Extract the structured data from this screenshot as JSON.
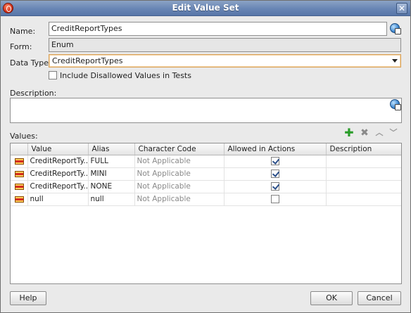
{
  "window": {
    "title": "Edit Value Set"
  },
  "form": {
    "name_label": "Name:",
    "name_value": "CreditReportTypes",
    "form_label": "Form:",
    "form_value": "Enum",
    "datatype_label": "Data Type:",
    "datatype_value": "CreditReportTypes",
    "include_disallowed_label": "Include Disallowed Values in Tests",
    "include_disallowed_checked": false,
    "description_label": "Description:",
    "description_value": ""
  },
  "values": {
    "label": "Values:",
    "columns": [
      "Value",
      "Alias",
      "Character Code",
      "Allowed in Actions",
      "Description"
    ],
    "rows": [
      {
        "value": "CreditReportTy...",
        "alias": "FULL",
        "char_code": "Not Applicable",
        "allowed": true,
        "description": ""
      },
      {
        "value": "CreditReportTy...",
        "alias": "MINI",
        "char_code": "Not Applicable",
        "allowed": true,
        "description": ""
      },
      {
        "value": "CreditReportTy...",
        "alias": "NONE",
        "char_code": "Not Applicable",
        "allowed": true,
        "description": ""
      },
      {
        "value": "null",
        "alias": "null",
        "char_code": "Not Applicable",
        "allowed": false,
        "description": ""
      }
    ]
  },
  "buttons": {
    "help": "Help",
    "ok": "OK",
    "cancel": "Cancel"
  },
  "icons": {
    "app": "oracle-logo-icon",
    "close": "close-icon",
    "translate": "globe-translate-icon",
    "add": "add-icon",
    "delete": "delete-icon",
    "move_up": "move-up-icon",
    "move_down": "move-down-icon",
    "row": "enum-value-icon"
  },
  "colors": {
    "titlebar": "#6885b4",
    "add": "#2a9d2a",
    "focus": "#d9a15a"
  }
}
